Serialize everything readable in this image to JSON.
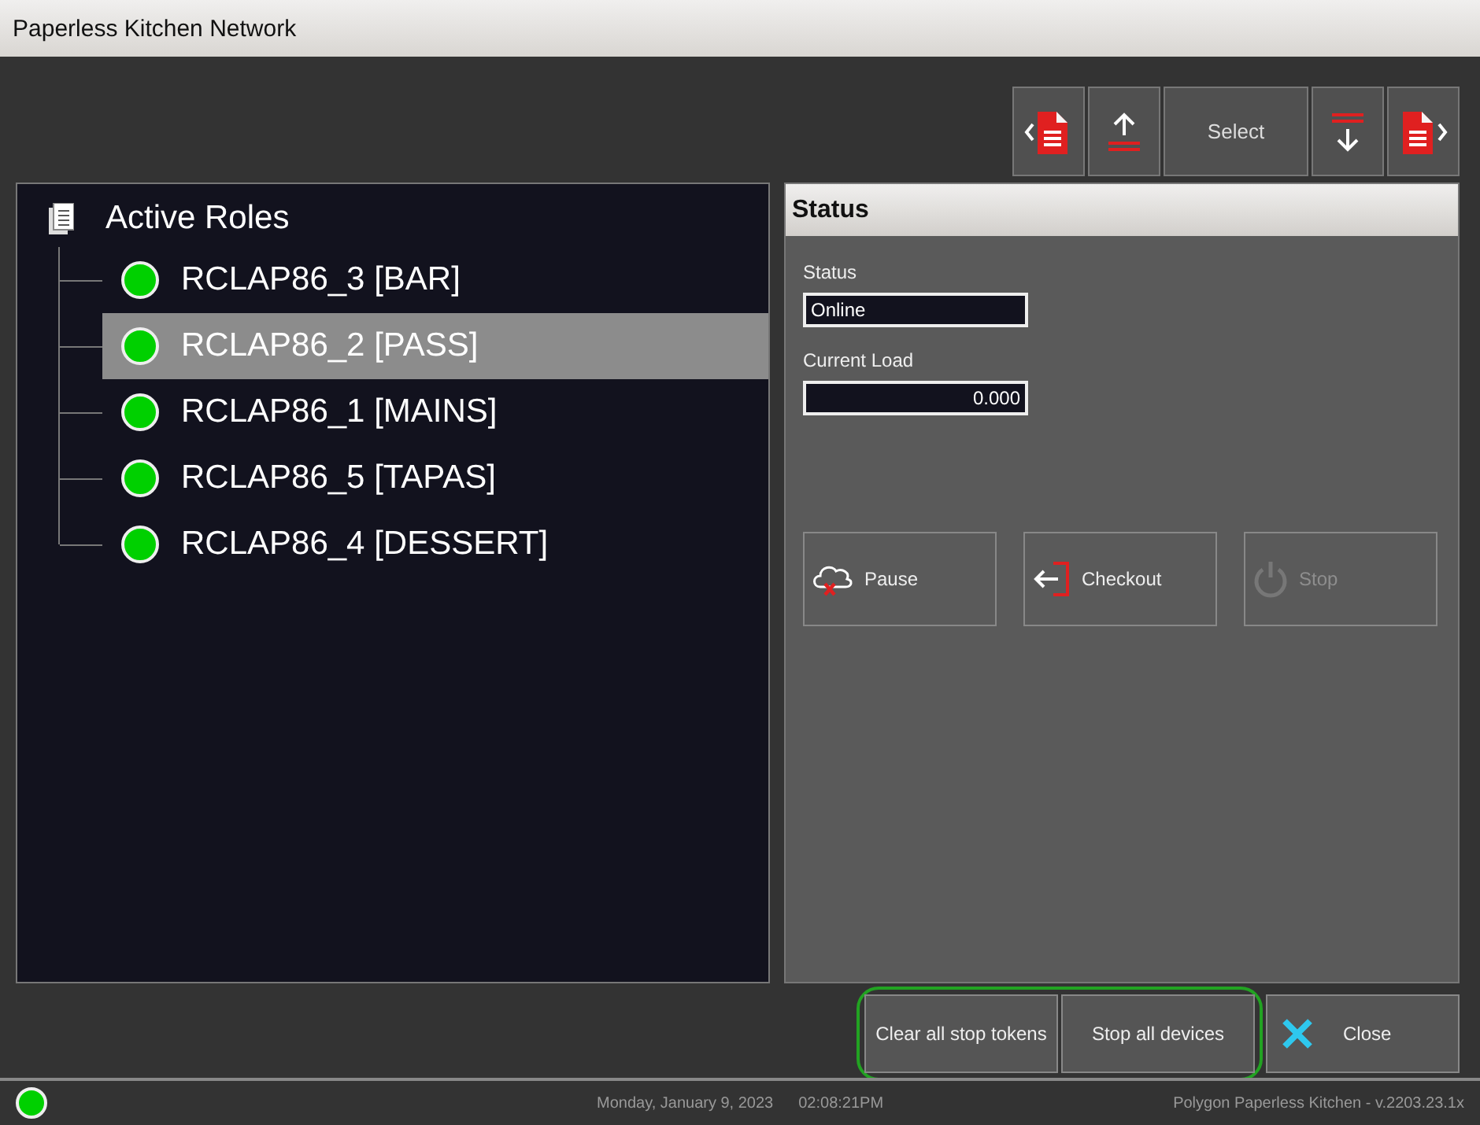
{
  "window": {
    "title": "Paperless Kitchen Network"
  },
  "toolbar": [
    {
      "kind": "prev"
    },
    {
      "kind": "up"
    },
    {
      "kind": "text",
      "label": "Select"
    },
    {
      "kind": "down"
    },
    {
      "kind": "next"
    }
  ],
  "tree": {
    "title": "Active Roles",
    "items": [
      {
        "label": "RCLAP86_3 [BAR]",
        "color": "#00d000",
        "selected": false
      },
      {
        "label": "RCLAP86_2 [PASS]",
        "color": "#00d000",
        "selected": true
      },
      {
        "label": "RCLAP86_1 [MAINS]",
        "color": "#00d000",
        "selected": false
      },
      {
        "label": "RCLAP86_5 [TAPAS]",
        "color": "#00d000",
        "selected": false
      },
      {
        "label": "RCLAP86_4 [DESSERT]",
        "color": "#00d000",
        "selected": false
      }
    ]
  },
  "status_panel": {
    "title": "Status",
    "fields": [
      {
        "label": "Status",
        "value": "Online",
        "kind": "text"
      },
      {
        "label": "Current Load",
        "value": "0.000",
        "kind": "number"
      }
    ],
    "actions": [
      {
        "kind": "pause",
        "label": "Pause",
        "disabled": false
      },
      {
        "kind": "checkout",
        "label": "Checkout",
        "disabled": false
      },
      {
        "kind": "stop",
        "label": "Stop",
        "disabled": true
      }
    ]
  },
  "bottom_buttons": [
    {
      "label": "Clear all stop tokens",
      "highlighted": true
    },
    {
      "label": "Stop all devices",
      "highlighted": true
    },
    {
      "label": "Close",
      "kind": "close",
      "highlighted": false
    }
  ],
  "status_bar": {
    "color": "#00d000",
    "date": "Monday, January  9, 2023",
    "time": "02:08:21PM",
    "version": "Polygon Paperless Kitchen - v.2203.23.1x"
  }
}
